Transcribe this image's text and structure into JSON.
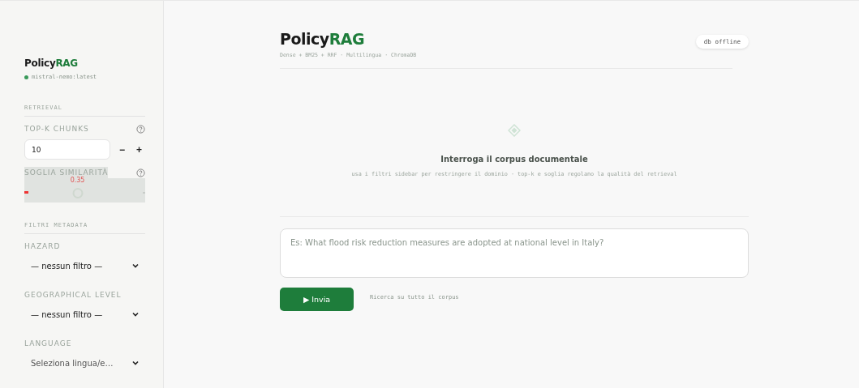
{
  "sidebar": {
    "brand": {
      "part_1": "Policy",
      "part_2": "RAG"
    },
    "model": {
      "name": "mistral-nemo:latest",
      "color": "#3a9a5a"
    },
    "retrieval": {
      "section": "RETRIEVAL",
      "top_k": {
        "label": "TOP-K CHUNKS",
        "value": "10",
        "minus": "−",
        "plus": "+"
      },
      "threshold": {
        "label": "SOGLIA SIMILARITÀ",
        "reading": "0.35",
        "level": 0.44
      }
    },
    "filters": {
      "section": "FILTRI METADATA",
      "items": [
        {
          "label": "HAZARD",
          "value": "— nessun filtro —",
          "placeholder": false
        },
        {
          "label": "GEOGRAPHICAL LEVEL",
          "value": "— nessun filtro —",
          "placeholder": false
        },
        {
          "label": "LANGUAGE",
          "value": "Seleziona lingua/e…",
          "placeholder": true
        }
      ]
    }
  },
  "header": {
    "title": {
      "part_1": "Policy",
      "part_2": "RAG"
    },
    "subtitle": "Dense + BM25 + RRF · Multilingua · ChromaDB",
    "status": "db offline"
  },
  "empty_state": {
    "title": "Interroga il corpus documentale",
    "hint": "usa i filtri sidebar per restringere il dominio · top-k e soglia regolano la qualità del retrieval"
  },
  "query": {
    "placeholder": "Es: What flood risk reduction measures are adopted at national level in Italy?",
    "submit": "▶ Invia",
    "scope": "Ricerca su tutto il corpus"
  }
}
